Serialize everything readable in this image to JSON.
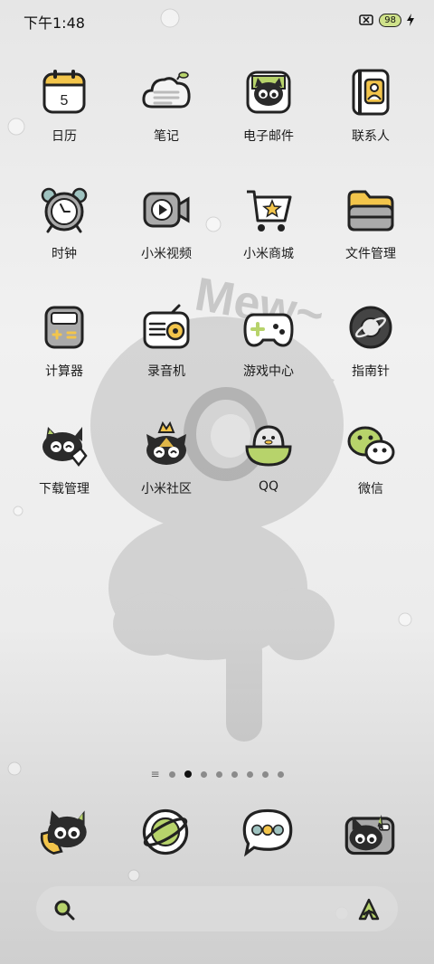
{
  "status_bar": {
    "time": "下午1:48",
    "battery": "98"
  },
  "apps": [
    {
      "label": "日历",
      "icon": "calendar-icon",
      "badge": "5"
    },
    {
      "label": "笔记",
      "icon": "notes-cloud-icon"
    },
    {
      "label": "电子邮件",
      "icon": "email-cat-icon"
    },
    {
      "label": "联系人",
      "icon": "contacts-icon"
    },
    {
      "label": "时钟",
      "icon": "alarm-clock-icon"
    },
    {
      "label": "小米视频",
      "icon": "video-play-icon"
    },
    {
      "label": "小米商城",
      "icon": "shopping-cart-icon"
    },
    {
      "label": "文件管理",
      "icon": "folder-icon"
    },
    {
      "label": "计算器",
      "icon": "calculator-icon"
    },
    {
      "label": "录音机",
      "icon": "radio-recorder-icon"
    },
    {
      "label": "游戏中心",
      "icon": "gamepad-icon"
    },
    {
      "label": "指南针",
      "icon": "compass-planet-icon"
    },
    {
      "label": "下载管理",
      "icon": "download-cat-icon"
    },
    {
      "label": "小米社区",
      "icon": "community-cat-icon"
    },
    {
      "label": "QQ",
      "icon": "qq-penguin-icon"
    },
    {
      "label": "微信",
      "icon": "wechat-icon"
    }
  ],
  "page_indicator": {
    "count": 8,
    "active": 1
  },
  "dock": [
    {
      "icon": "phone-cat-icon"
    },
    {
      "icon": "browser-planet-icon"
    },
    {
      "icon": "messages-bubble-icon"
    },
    {
      "icon": "camera-cat-icon"
    }
  ],
  "search_bar": {
    "left_icon": "search-icon",
    "right_icon": "assistant-a-icon"
  },
  "wallpaper": {
    "text": "Mew~"
  }
}
